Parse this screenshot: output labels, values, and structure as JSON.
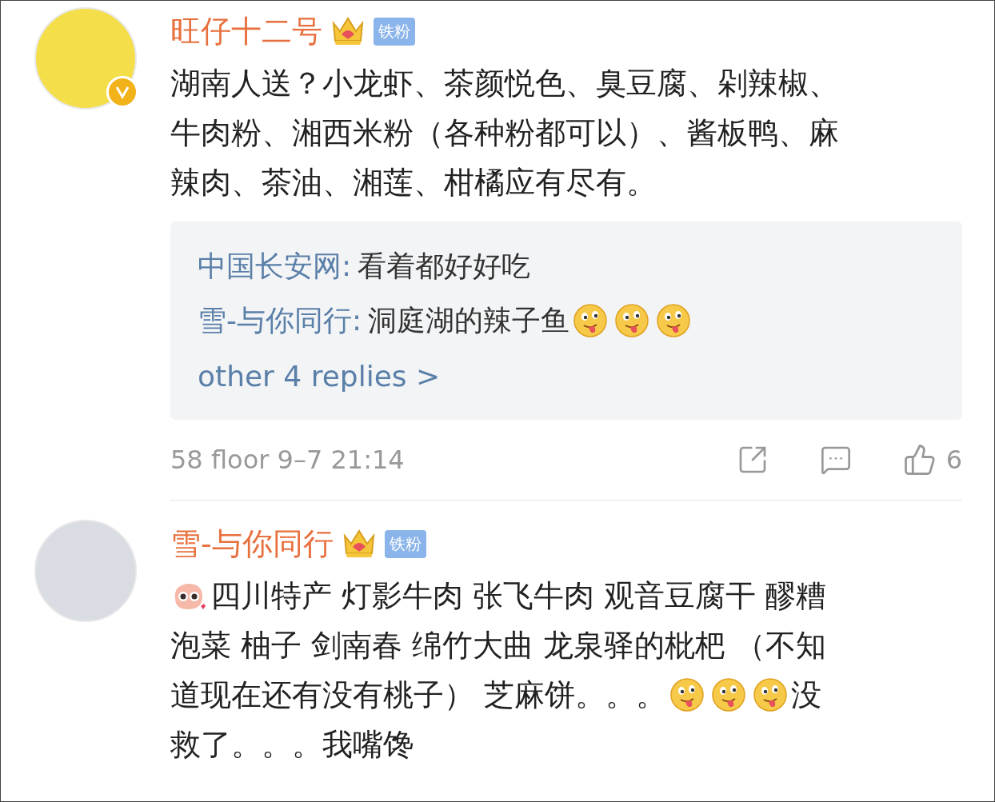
{
  "comments": [
    {
      "username": "旺仔十二号",
      "fan_badge": "铁粉",
      "verified": true,
      "body": [
        [
          {
            "kind": "text",
            "text": "湖南人送？小龙虾、茶颜悦色、臭豆腐、剁辣椒、"
          }
        ],
        [
          {
            "kind": "text",
            "text": "牛肉粉、湘西米粉（各种粉都可以）、酱板鸭、麻"
          }
        ],
        [
          {
            "kind": "text",
            "text": "辣肉、茶油、湘莲、柑橘应有尽有。"
          }
        ]
      ],
      "replies": [
        {
          "author": "中国长安网:",
          "parts": [
            {
              "kind": "text",
              "text": "看着都好好吃"
            }
          ]
        },
        {
          "author": "雪-与你同行:",
          "parts": [
            {
              "kind": "text",
              "text": "洞庭湖的辣子鱼"
            },
            {
              "kind": "emoji-tongue"
            },
            {
              "kind": "emoji-tongue"
            },
            {
              "kind": "emoji-tongue"
            }
          ]
        }
      ],
      "more_replies": "other 4 replies >",
      "meta": "58 floor 9–7 21:14",
      "likes": "6"
    },
    {
      "username": "雪-与你同行",
      "fan_badge": "铁粉",
      "verified": false,
      "body": [
        [
          {
            "kind": "emoji-cute"
          },
          {
            "kind": "text",
            "text": "四川特产 灯影牛肉 张飞牛肉 观音豆腐干 醪糟"
          }
        ],
        [
          {
            "kind": "text",
            "text": "泡菜 柚子 剑南春 绵竹大曲 龙泉驿的枇杷 （不知"
          }
        ],
        [
          {
            "kind": "text",
            "text": "道现在还有没有桃子） 芝麻饼。。。"
          },
          {
            "kind": "emoji-tongue"
          },
          {
            "kind": "emoji-tongue"
          },
          {
            "kind": "emoji-tongue"
          },
          {
            "kind": "text",
            "text": "没"
          }
        ],
        [
          {
            "kind": "text",
            "text": "救了。。。我嘴馋"
          }
        ]
      ]
    }
  ]
}
